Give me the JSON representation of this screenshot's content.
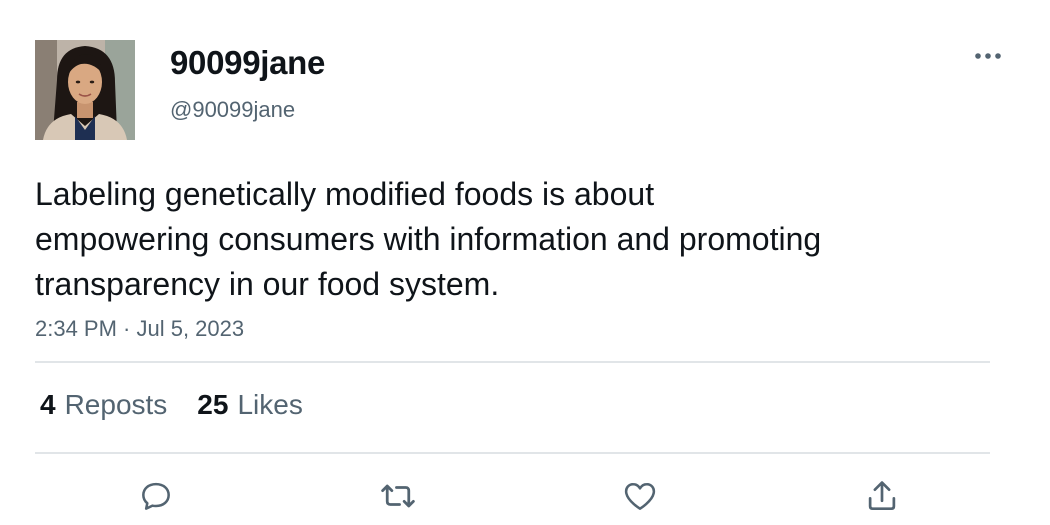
{
  "user": {
    "display_name": "90099jane",
    "handle": "@90099jane",
    "avatar_icon": "profile-photo"
  },
  "tweet": {
    "text": "Labeling genetically modified foods is about\nempowering consumers with information and promoting\ntransparency in our food system.",
    "timestamp": "2:34 PM · Jul 5, 2023"
  },
  "stats": {
    "reposts_count": "4",
    "reposts_label": "Reposts",
    "likes_count": "25",
    "likes_label": "Likes"
  },
  "actions": [
    {
      "name": "reply",
      "icon": "speech-bubble-icon"
    },
    {
      "name": "repost",
      "icon": "repost-arrows-icon"
    },
    {
      "name": "like",
      "icon": "heart-icon"
    },
    {
      "name": "share",
      "icon": "upload-icon"
    }
  ],
  "colors": {
    "text_primary": "#0f1419",
    "text_secondary": "#536471",
    "divider": "#e1e5e8",
    "icon": "#536471"
  }
}
